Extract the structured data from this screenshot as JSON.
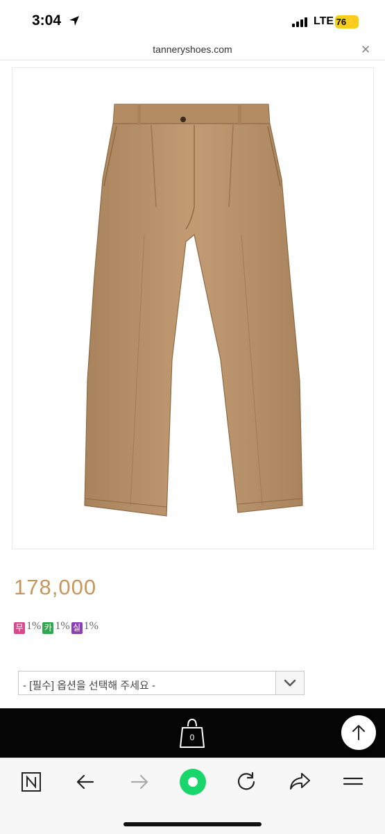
{
  "status_bar": {
    "time": "3:04",
    "network": "LTE",
    "battery": "76"
  },
  "browser": {
    "url": "tanneryshoes.com",
    "close_icon": "close-icon"
  },
  "product": {
    "image": "khaki-pleated-chino-trousers",
    "price": "178,000",
    "points": [
      {
        "badge": "무",
        "percent": "1%",
        "color": "#d9488b"
      },
      {
        "badge": "카",
        "percent": "1%",
        "color": "#2fa84f"
      },
      {
        "badge": "실",
        "percent": "1%",
        "color": "#8a3fb8"
      }
    ],
    "option_placeholder": "- [필수] 옵션을 선택해 주세요 -"
  },
  "bottom_bar": {
    "cart_count": "0"
  },
  "toolbar": {
    "items": [
      "naver-icon",
      "back-icon",
      "forward-icon",
      "green-home-icon",
      "refresh-icon",
      "share-icon",
      "menu-icon"
    ]
  }
}
